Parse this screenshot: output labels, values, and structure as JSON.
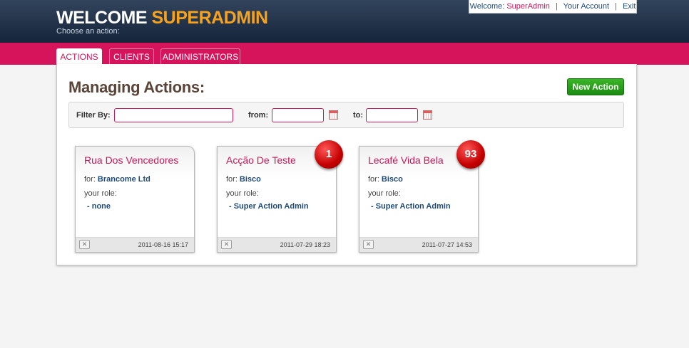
{
  "header": {
    "brand_prefix": "WELCOME",
    "brand_name": "SUPERADMIN",
    "subtitle": "Choose an action:",
    "welcome_label": "Welcome:",
    "user_name": "SuperAdmin",
    "account_link": "Your Account",
    "exit_link": "Exit",
    "separator": "|"
  },
  "tabs": [
    {
      "label": "ACTIONS",
      "active": true
    },
    {
      "label": "CLIENTS",
      "active": false
    },
    {
      "label": "ADMINISTRATORS",
      "active": false
    }
  ],
  "page": {
    "title": "Managing Actions:",
    "new_button": "New Action"
  },
  "filter": {
    "filter_label": "Filter By:",
    "from_label": "from:",
    "to_label": "to:",
    "filter_value": "",
    "from_value": "",
    "to_value": ""
  },
  "cards": [
    {
      "title": "Rua Dos Vencedores",
      "for_label": "for:",
      "client": "Brancome Ltd",
      "role_label": "your role:",
      "role": "- none",
      "date": "2011-08-16 15:17",
      "badge": ""
    },
    {
      "title": "Acção De Teste",
      "for_label": "for:",
      "client": "Bisco",
      "role_label": "your role:",
      "role": "- Super Action Admin",
      "date": "2011-07-29 18:23",
      "badge": "1"
    },
    {
      "title": "Lecafé Vida Bela",
      "for_label": "for:",
      "client": "Bisco",
      "role_label": "your role:",
      "role": "- Super Action Admin",
      "date": "2011-07-27 14:53",
      "badge": "93"
    }
  ],
  "colors": {
    "accent_pink": "#d6145c",
    "brand_orange": "#f7a21d",
    "header_navy": "#15253a",
    "button_green": "#1c8a12",
    "badge_red": "#c40000"
  },
  "icons": {
    "calendar": "calendar-icon",
    "close": "close-icon"
  }
}
